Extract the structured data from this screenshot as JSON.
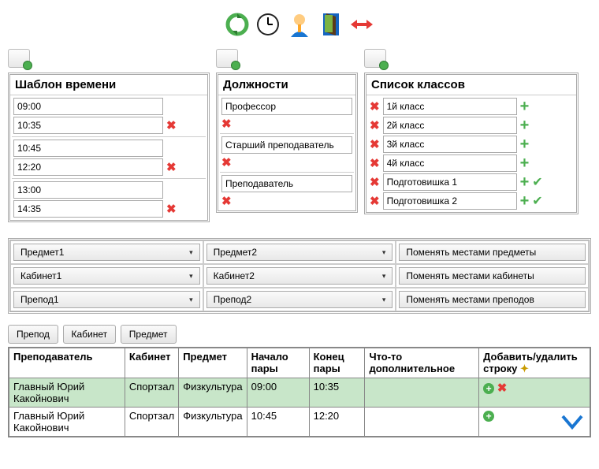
{
  "toolbar": {
    "refresh": "refresh-icon",
    "clock": "clock-icon",
    "user": "user-icon",
    "door": "door-icon",
    "resize": "resize-icon"
  },
  "timeTemplate": {
    "title": "Шаблон времени",
    "pairs": [
      {
        "start": "09:00",
        "end": "10:35"
      },
      {
        "start": "10:45",
        "end": "12:20"
      },
      {
        "start": "13:00",
        "end": "14:35"
      }
    ]
  },
  "positions": {
    "title": "Должности",
    "items": [
      "Профессор",
      "Старший преподаватель",
      "Преподаватель"
    ]
  },
  "classes": {
    "title": "Список классов",
    "items": [
      {
        "name": "1й класс",
        "check": false
      },
      {
        "name": "2й класс",
        "check": false
      },
      {
        "name": "3й класс",
        "check": false
      },
      {
        "name": "4й класс",
        "check": false
      },
      {
        "name": "Подготовишка 1",
        "check": true
      },
      {
        "name": "Подготовишка 2",
        "check": true
      }
    ]
  },
  "swap": {
    "subject1": "Предмет1",
    "subject2": "Предмет2",
    "swapSubjects": "Поменять местами предметы",
    "room1": "Кабинет1",
    "room2": "Кабинет2",
    "swapRooms": "Поменять местами кабинеты",
    "teacher1": "Препод1",
    "teacher2": "Препод2",
    "swapTeachers": "Поменять местами преподов"
  },
  "tabs": {
    "teacher": "Препод",
    "room": "Кабинет",
    "subject": "Предмет"
  },
  "schedule": {
    "headers": {
      "teacher": "Преподаватель",
      "room": "Кабинет",
      "subject": "Предмет",
      "start": "Начало пары",
      "end": "Конец пары",
      "extra": "Что-то дополнительное",
      "add": "Добавить/удалить строку"
    },
    "rows": [
      {
        "teacher": "Главный Юрий Какойнович",
        "room": "Спортзал",
        "subject": "Физкультура",
        "start": "09:00",
        "end": "10:35",
        "green": true,
        "del": true
      },
      {
        "teacher": "Главный Юрий Какойнович",
        "room": "Спортзал",
        "subject": "Физкультура",
        "start": "10:45",
        "end": "12:20",
        "green": false,
        "del": false
      }
    ]
  }
}
